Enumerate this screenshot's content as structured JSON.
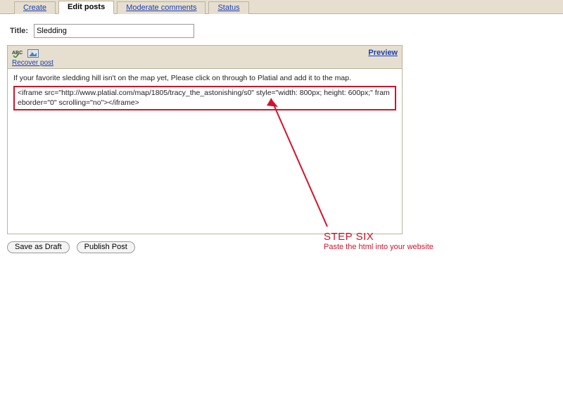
{
  "tabs": {
    "create": "Create",
    "edit": "Edit posts",
    "moderate": "Moderate comments",
    "status": "Status"
  },
  "title": {
    "label": "Title:",
    "value": "Sledding"
  },
  "toolbar": {
    "recover": "Recover post",
    "preview": "Preview"
  },
  "body": {
    "intro": "If your favorite sledding hill isn't on the map yet, Please click on through to Platial and add it to the map.",
    "code": "<iframe src=\"http://www.platial.com/map/1805/tracy_the_astonishing/s0\" style=\"width: 800px; height: 600px;\" frameborder=\"0\" scrolling=\"no\"></iframe>"
  },
  "buttons": {
    "draft": "Save as Draft",
    "publish": "Publish Post"
  },
  "annotation": {
    "step": "STEP SIX",
    "caption": "Paste the html into your website"
  }
}
